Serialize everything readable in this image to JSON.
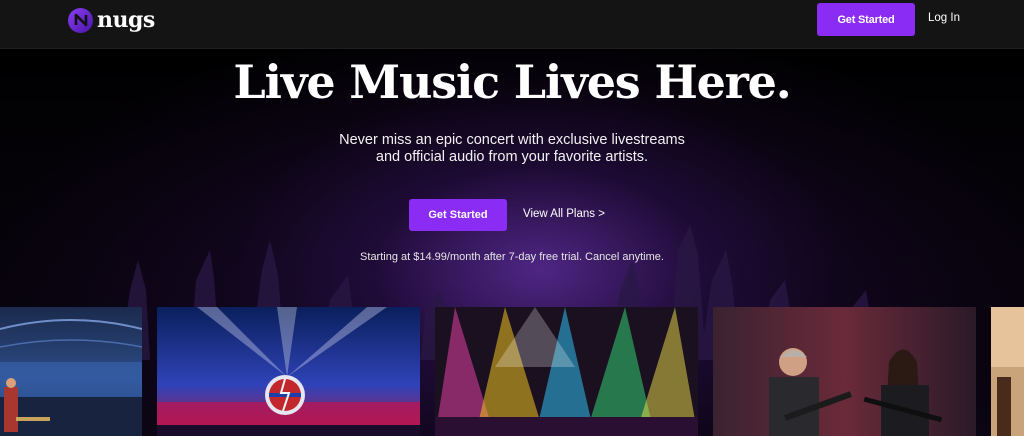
{
  "header": {
    "brand": "nugs",
    "get_started_label": "Get Started",
    "login_label": "Log In"
  },
  "hero": {
    "headline": "Live Music Lives Here.",
    "subline_1": "Never miss an epic concert with exclusive livestreams",
    "subline_2": "and official audio from your favorite artists.",
    "cta_label": "Get Started",
    "view_plans_label": "View All Plans >",
    "pricing_note": "Starting at $14.99/month after 7-day free trial. Cancel anytime."
  },
  "gallery": {
    "tiles": [
      "stadium-concert-photo",
      "stage-skull-logo-photo",
      "stage-lights-photo",
      "guitarists-photo",
      "partial-photo"
    ]
  },
  "colors": {
    "accent": "#8b2cf5",
    "topbar": "#141414",
    "background": "#000000"
  },
  "icons": {
    "logo": "nugs-logo-icon"
  }
}
